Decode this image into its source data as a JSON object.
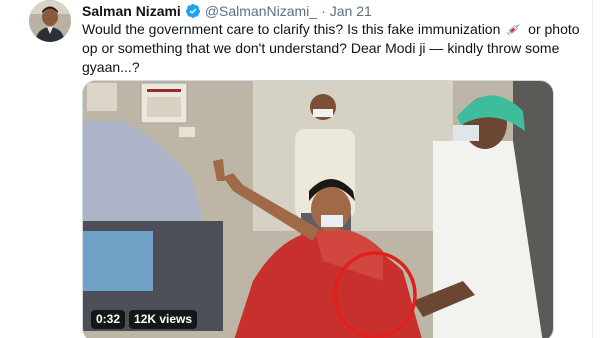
{
  "tweet": {
    "author_name": "Salman Nizami",
    "handle": "@SalmanNizami_",
    "separator": "·",
    "date": "Jan 21",
    "text_part1": "Would the government care to clarify this? Is this fake immunization",
    "text_part2": "or photo op or something that we don't understand? Dear Modi ji — kindly throw some gyaan...?",
    "verified_icon": "verified-badge-icon",
    "emoji_icon": "syringe-icon"
  },
  "video": {
    "duration": "0:32",
    "views": "12K views"
  },
  "colors": {
    "verified": "#1da1f2",
    "secondary_text": "#5b7083",
    "highlight_circle": "#e0201c"
  }
}
